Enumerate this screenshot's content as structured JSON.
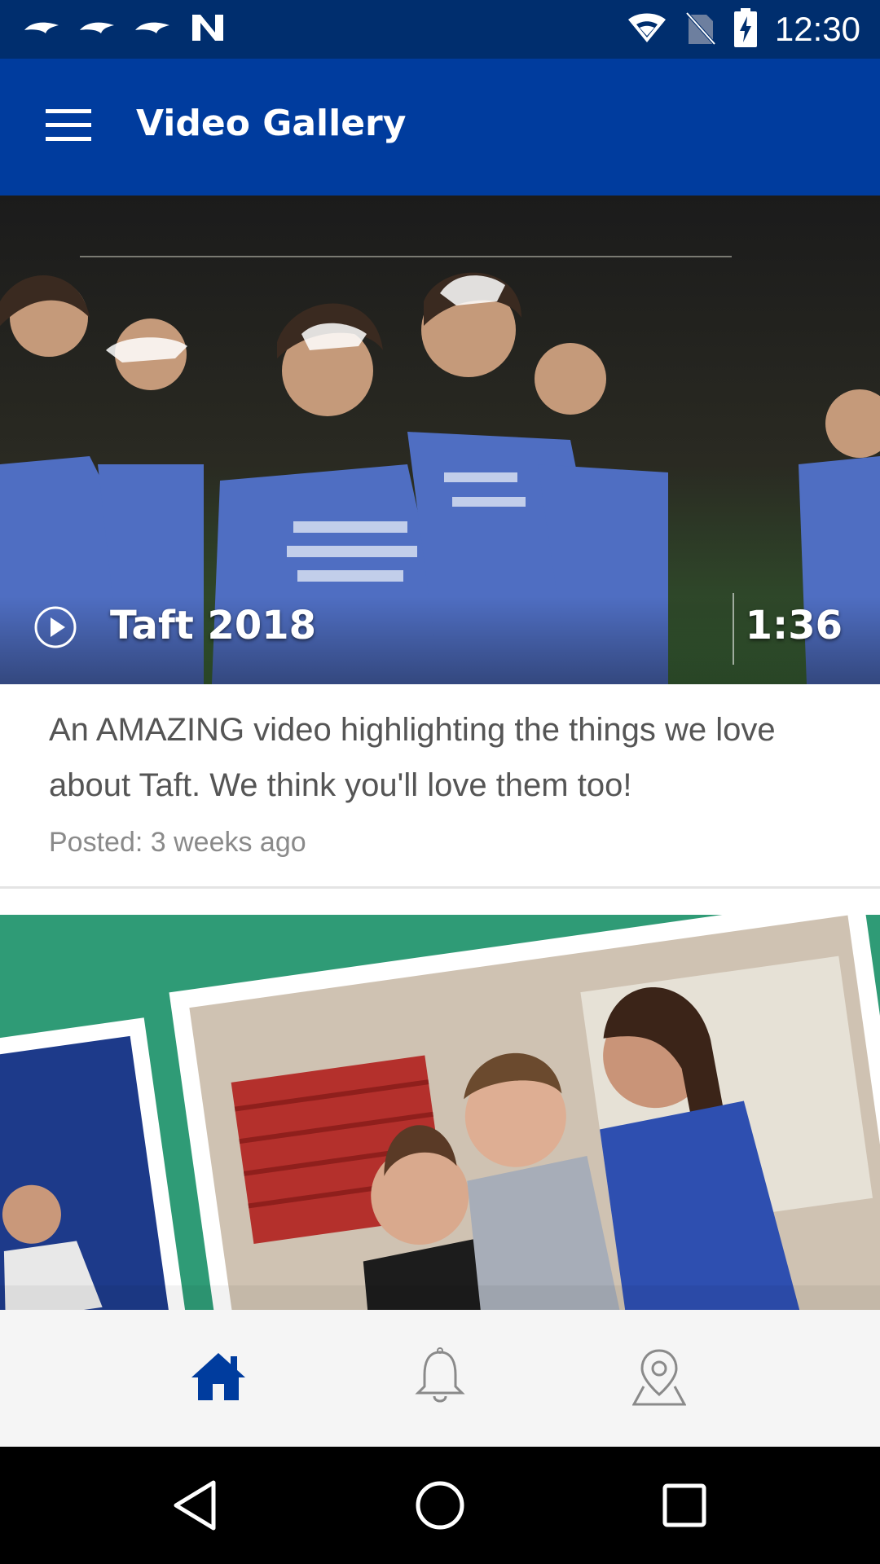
{
  "status_bar": {
    "time": "12:30",
    "left_icons": [
      "bird-icon",
      "bird-icon",
      "bird-icon",
      "n-icon"
    ],
    "right_icons": [
      "wifi-icon",
      "no-sim-icon",
      "battery-charging-icon"
    ]
  },
  "app_bar": {
    "title": "Video Gallery",
    "menu_icon": "hamburger-menu-icon",
    "background_color": "#003c9e"
  },
  "videos": [
    {
      "title": "Taft 2018",
      "duration": "1:36",
      "description": "An AMAZING video highlighting the things we love about Taft. We think you'll love them too!",
      "posted": "Posted: 3 weeks ago"
    }
  ],
  "bottom_nav": {
    "items": [
      {
        "icon": "home-icon",
        "active": true
      },
      {
        "icon": "bell-icon",
        "active": false
      },
      {
        "icon": "location-pin-icon",
        "active": false
      }
    ],
    "active_color": "#003c9e"
  },
  "system_nav": {
    "items": [
      "back-icon",
      "home-circle-icon",
      "recents-square-icon"
    ]
  }
}
